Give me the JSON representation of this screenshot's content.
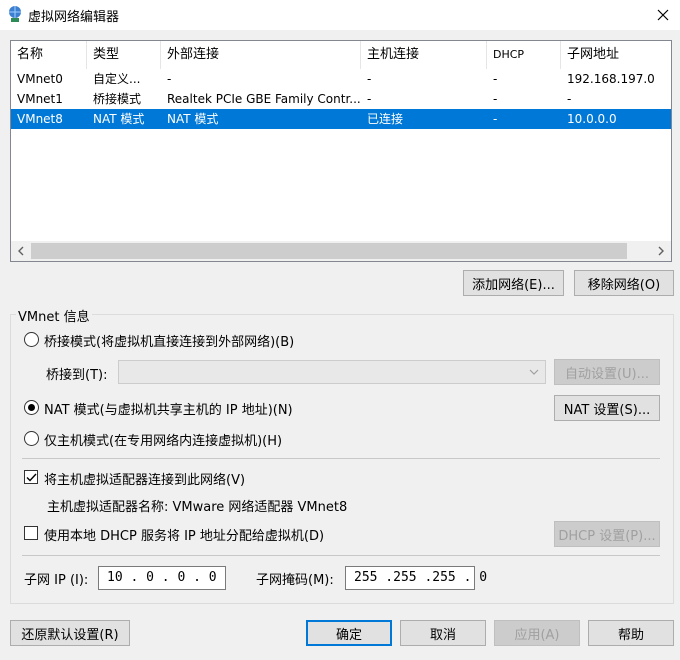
{
  "window": {
    "title": "虚拟网络编辑器",
    "close_icon": "close-icon"
  },
  "table": {
    "columns": [
      "名称",
      "类型",
      "外部连接",
      "主机连接",
      "DHCP",
      "子网地址"
    ],
    "rows": [
      {
        "name": "VMnet0",
        "type": "自定义...",
        "external": "-",
        "host": "-",
        "dhcp": "-",
        "subnet": "192.168.197.0",
        "selected": false
      },
      {
        "name": "VMnet1",
        "type": "桥接模式",
        "external": "Realtek PCIe GBE Family Contr...",
        "host": "-",
        "dhcp": "-",
        "subnet": "-",
        "selected": false
      },
      {
        "name": "VMnet8",
        "type": "NAT 模式",
        "external": "NAT 模式",
        "host": "已连接",
        "dhcp": "-",
        "subnet": "10.0.0.0",
        "selected": true
      }
    ]
  },
  "list_buttons": {
    "add": "添加网络(E)...",
    "remove": "移除网络(O)"
  },
  "vmnet_info": {
    "title": "VMnet 信息",
    "bridged_label": "桥接模式(将虚拟机直接连接到外部网络)(B)",
    "bridge_to_label": "桥接到(T):",
    "auto_settings": "自动设置(U)...",
    "nat_label": "NAT 模式(与虚拟机共享主机的 IP 地址)(N)",
    "nat_settings": "NAT 设置(S)...",
    "host_only_label": "仅主机模式(在专用网络内连接虚拟机)(H)",
    "connect_adapter_label": "将主机虚拟适配器连接到此网络(V)",
    "adapter_name_label": "主机虚拟适配器名称: VMware 网络适配器 VMnet8",
    "dhcp_label": "使用本地 DHCP 服务将 IP 地址分配给虚拟机(D)",
    "dhcp_settings": "DHCP 设置(P)...",
    "subnet_ip_label": "子网 IP (I):",
    "subnet_ip_value": "10 . 0 . 0 . 0",
    "subnet_mask_label": "子网掩码(M):",
    "subnet_mask_value": "255 .255 .255 . 0",
    "mode": "nat",
    "connect_adapter_checked": true,
    "dhcp_checked": false
  },
  "footer": {
    "restore": "还原默认设置(R)",
    "ok": "确定",
    "cancel": "取消",
    "apply": "应用(A)",
    "help": "帮助"
  },
  "colors": {
    "selection": "#0078d7",
    "window_bg": "#f0f0f0"
  }
}
